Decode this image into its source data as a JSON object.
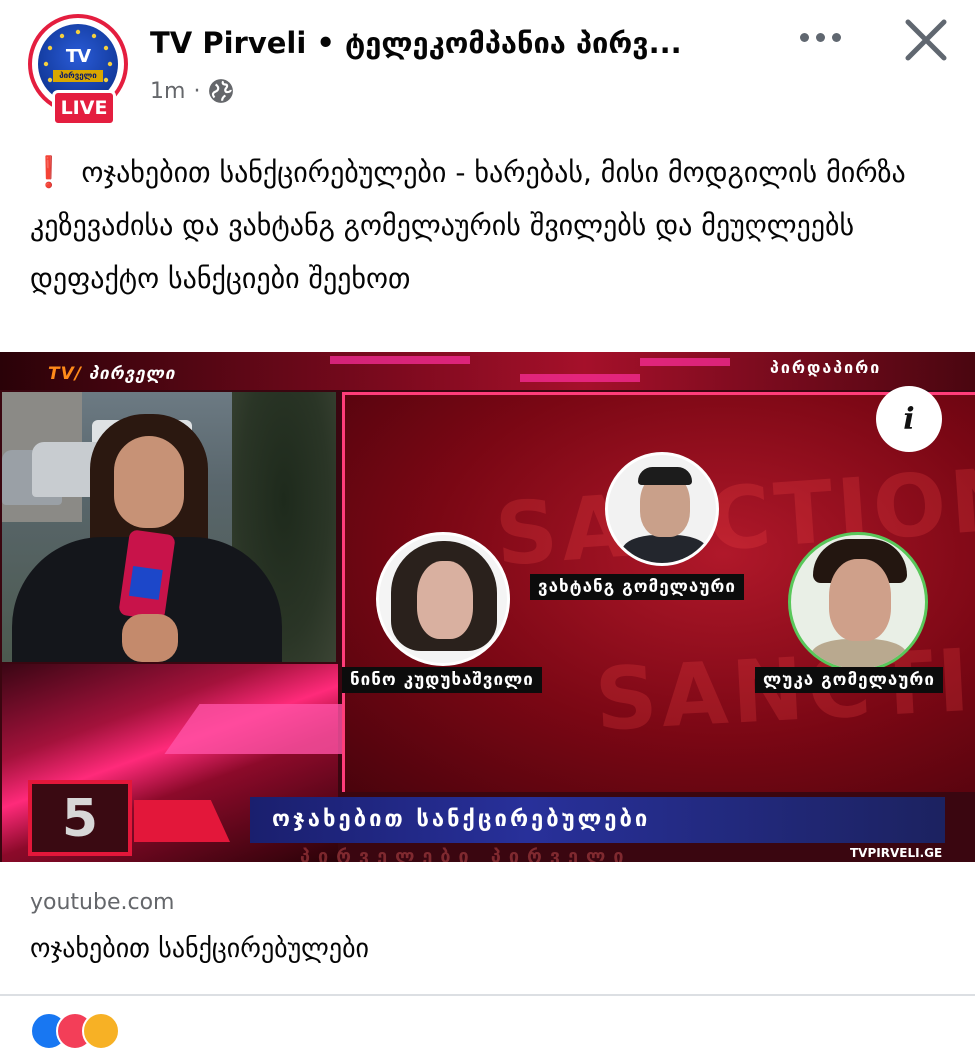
{
  "post": {
    "page_name": "TV Pirveli • ტელეკომპანია პირვ...",
    "time": "1m",
    "separator": "·",
    "live_label": "LIVE",
    "avatar_logo_text": "TV",
    "avatar_sub_text": "პირველი",
    "caption_icon": "❗",
    "caption": "ოჯახებით სანქცირებულები - ხარებას, მისი მოდგილის მირზა კეზევაძისა  და ვახტანგ გომელაურის შვილებს და მეუღლეებს დეფაქტო სანქციები შეეხოთ"
  },
  "video": {
    "brand_tv": "TV/",
    "brand_name": "პირველი",
    "brand_right": "პირდაპირი",
    "info_label": "i",
    "bg_word_1": "SANCTIONS",
    "bg_word_2": "SANCTIONS",
    "people": [
      {
        "name": "ვახტანგ გომელაური"
      },
      {
        "name": "ნინო კუდუხაშვილი"
      },
      {
        "name": "ლუკა გომელაური"
      }
    ],
    "ticker_number": "5",
    "ticker_title": "ოჯახებით სანქცირებულები",
    "ticker_under": "პირველები   პირველი",
    "site_mark": "TVPIRVELI.GE"
  },
  "link": {
    "domain": "youtube.com",
    "title": "ოჯახებით სანქცირებულები"
  },
  "icons": {
    "more": "more-horizontal-icon",
    "close": "close-icon",
    "privacy": "globe-icon",
    "info": "info-icon"
  },
  "colors": {
    "live_red": "#e41e3f",
    "meta_gray": "#65676b",
    "ticker_blue": "#28309a"
  }
}
